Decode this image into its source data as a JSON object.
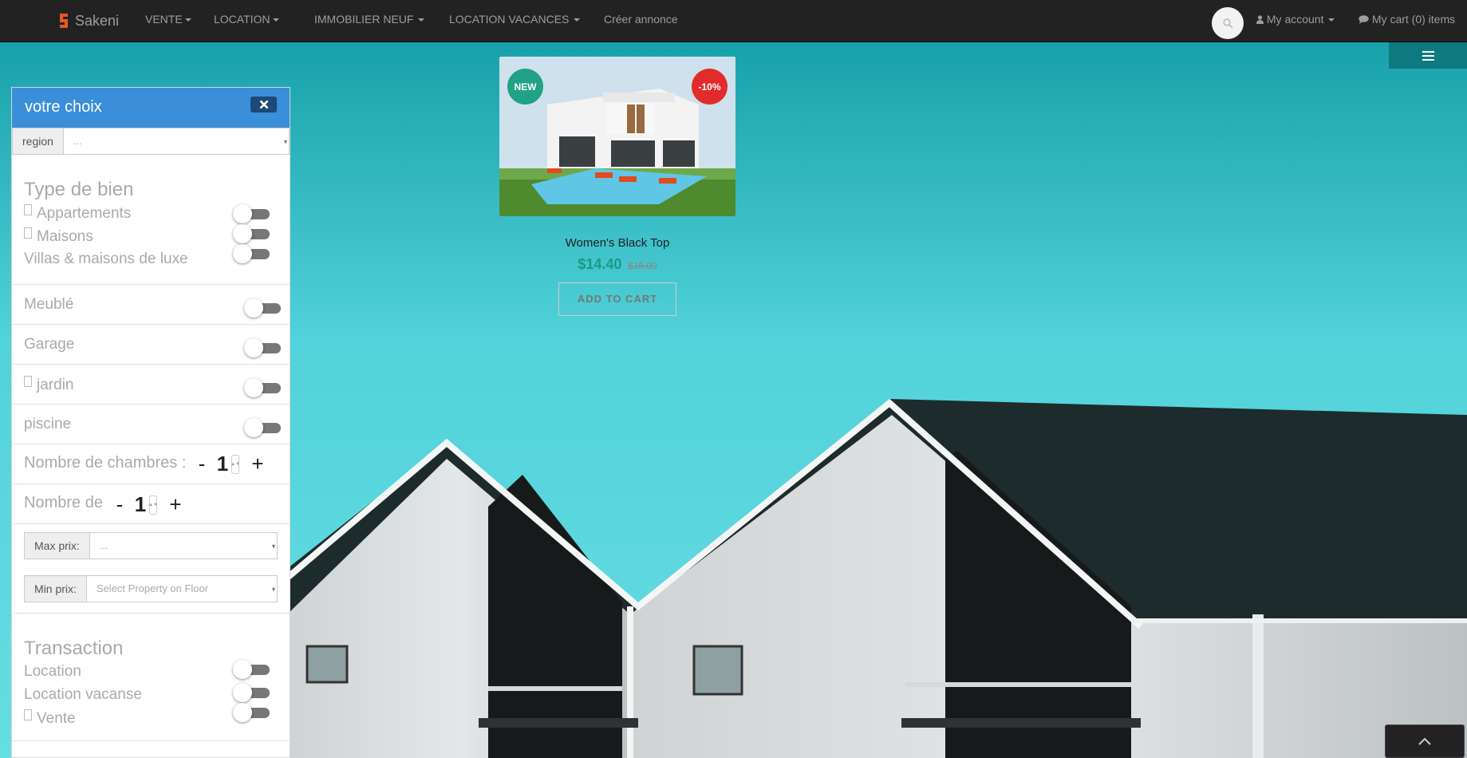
{
  "navbar": {
    "brand": "Sakeni",
    "items": [
      {
        "label": "VENTE",
        "dropdown": true
      },
      {
        "label": "LOCATION",
        "dropdown": true
      },
      {
        "label": "IMMOBILIER NEUF",
        "dropdown": true
      },
      {
        "label": "LOCATION VACANCES",
        "dropdown": true
      },
      {
        "label": "Créer annonce",
        "dropdown": false
      }
    ],
    "account": "My account",
    "cart": "My cart (0) items",
    "search_icon": "search-icon",
    "menu_icon": "bars-icon"
  },
  "product": {
    "badge_new": "NEW",
    "badge_sale": "-10%",
    "name": "Women's Black Top",
    "price": "$14.40",
    "old_price": "$16.00",
    "add_to_cart": "ADD TO CART"
  },
  "panel": {
    "title": "votre choix",
    "region_label": "region",
    "region_value": "...",
    "type_title": "Type de bien",
    "types": [
      {
        "label": "Appartements",
        "icon": true
      },
      {
        "label": "Maisons",
        "icon": true
      },
      {
        "label": "Villas & maisons de luxe",
        "icon": false
      }
    ],
    "meuble": "Meublé",
    "garage": "Garage",
    "jardin": "jardin",
    "piscine": "piscine",
    "chambres_label": "Nombre de chambres :",
    "chambres_value": "1",
    "nombre_label": "Nombre de",
    "nombre_value": "1",
    "minus": "-",
    "plus": "+",
    "max_label": "Max prix:",
    "max_value": "...",
    "min_label": "Min prix:",
    "min_placeholder": "Select Property on Floor",
    "transaction_title": "Transaction",
    "transactions": [
      {
        "label": "Location",
        "icon": false
      },
      {
        "label": "Location vacanse",
        "icon": false
      },
      {
        "label": "Vente",
        "icon": true
      }
    ]
  },
  "colors": {
    "navbar": "#222222",
    "panel_header": "#3b8ed8",
    "price": "#1a9a86",
    "sky": "#5fd6dc",
    "badge_new": "#1fa286",
    "badge_sale": "#e22b2b"
  }
}
